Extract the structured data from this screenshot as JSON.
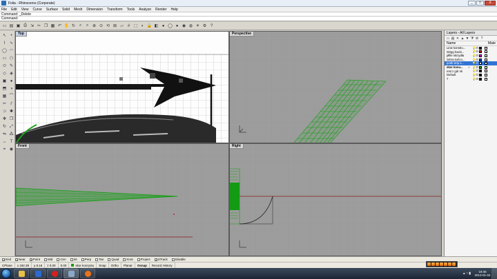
{
  "window": {
    "title": "Folia - Rhinoceros (Corporate)",
    "controls": [
      "_",
      "□",
      "X"
    ]
  },
  "menu": [
    "File",
    "Edit",
    "View",
    "Curve",
    "Surface",
    "Solid",
    "Mesh",
    "Dimension",
    "Transform",
    "Tools",
    "Analyze",
    "Render",
    "Help"
  ],
  "command": {
    "history": "Command: _Delete",
    "prompt": "Command:"
  },
  "viewports": {
    "top": {
      "label": "Top"
    },
    "perspective": {
      "label": "Perspective"
    },
    "front": {
      "label": "Front"
    },
    "right": {
      "label": "Right"
    }
  },
  "layers_panel": {
    "title": "Layers - All Layers",
    "col_name": "Name",
    "col_material": "Mate",
    "tool_icons": [
      "new-layer",
      "new-sublayer",
      "delete",
      "move-up",
      "move-down",
      "filter",
      "tools",
      "help"
    ],
    "rows": [
      {
        "name": "Linie konstru...",
        "color": "#1a1a1a",
        "selected": false,
        "current": false
      },
      {
        "name": "Wzgg hacki...",
        "color": "#cc1a1a",
        "selected": false,
        "current": false
      },
      {
        "name": "płfile skrzydła",
        "color": "#d41ad4",
        "selected": false,
        "current": false
      },
      {
        "name": "żebra końco...",
        "color": "#1a4ad4",
        "selected": false,
        "current": false
      },
      {
        "name": "podk strip s...",
        "color": "#e8e8e8",
        "selected": true,
        "current": false
      },
      {
        "name": "skor konu...",
        "color": "#1a9a1a",
        "selected": false,
        "current": true
      },
      {
        "name": "rest z gdr nk",
        "color": "#1a1a1a",
        "selected": false,
        "current": false
      },
      {
        "name": "Default",
        "color": "#1a1a1a",
        "selected": false,
        "current": false
      },
      {
        "name": "7",
        "color": "#1a1a1a",
        "selected": false,
        "current": false
      }
    ]
  },
  "osnap": [
    {
      "label": "End",
      "checked": true
    },
    {
      "label": "Near",
      "checked": true
    },
    {
      "label": "Point",
      "checked": true
    },
    {
      "label": "Mid",
      "checked": false
    },
    {
      "label": "Cen",
      "checked": false
    },
    {
      "label": "Int",
      "checked": false
    },
    {
      "label": "Perp",
      "checked": false
    },
    {
      "label": "Tan",
      "checked": false
    },
    {
      "label": "Quad",
      "checked": false
    },
    {
      "label": "Knot",
      "checked": false
    },
    {
      "label": "Project",
      "checked": false
    },
    {
      "label": "STrack",
      "checked": true
    },
    {
      "label": "Disable",
      "checked": false
    }
  ],
  "status": {
    "cplane": "CPlane",
    "x": "x 192.38",
    "y": "y 8.16",
    "z": "z 0.00",
    "units": "0.00",
    "layer": "skor konrystu",
    "snap": "Snap",
    "ortho": "Ortho",
    "planar": "Planar",
    "osnap": "Osnap",
    "record": "Record History"
  },
  "taskbar": {
    "apps": [
      "explorer",
      "media",
      "opera",
      "rhino",
      "firefox"
    ],
    "time": "19:46",
    "date": "2013-01-04"
  }
}
